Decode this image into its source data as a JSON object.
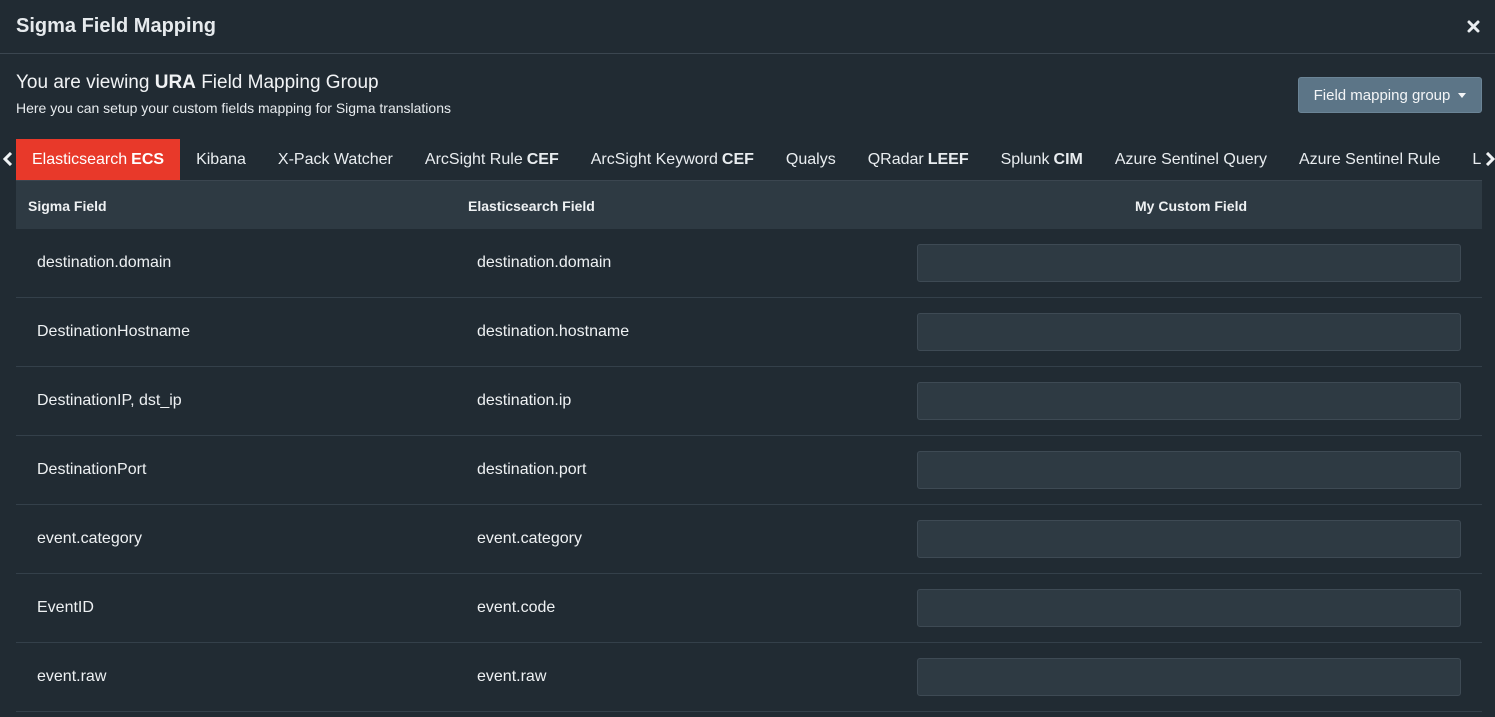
{
  "modal": {
    "title": "Sigma Field Mapping",
    "close_icon": "close-icon"
  },
  "intro": {
    "prefix": "You are viewing",
    "group_name": "URA",
    "suffix": "Field Mapping Group",
    "subtitle": "Here you can setup your custom fields mapping for Sigma translations"
  },
  "group_button": {
    "label": "Field mapping group",
    "icon": "caret-down-icon"
  },
  "tabs": [
    {
      "label": "Elasticsearch",
      "bold": "ECS",
      "active": true
    },
    {
      "label": "Kibana",
      "bold": ""
    },
    {
      "label": "X-Pack Watcher",
      "bold": ""
    },
    {
      "label": "ArcSight Rule",
      "bold": "CEF"
    },
    {
      "label": "ArcSight Keyword",
      "bold": "CEF"
    },
    {
      "label": "Qualys",
      "bold": ""
    },
    {
      "label": "QRadar",
      "bold": "LEEF"
    },
    {
      "label": "Splunk",
      "bold": "CIM"
    },
    {
      "label": "Azure Sentinel Query",
      "bold": ""
    },
    {
      "label": "Azure Sentinel Rule",
      "bold": ""
    },
    {
      "label": "Logpoint",
      "bold": ""
    }
  ],
  "table": {
    "headers": {
      "sigma": "Sigma Field",
      "target": "Elasticsearch Field",
      "custom": "My Custom Field"
    },
    "rows": [
      {
        "sigma": "destination.domain",
        "target": "destination.domain",
        "custom": ""
      },
      {
        "sigma": "DestinationHostname",
        "target": "destination.hostname",
        "custom": ""
      },
      {
        "sigma": "DestinationIP, dst_ip",
        "target": "destination.ip",
        "custom": ""
      },
      {
        "sigma": "DestinationPort",
        "target": "destination.port",
        "custom": ""
      },
      {
        "sigma": "event.category",
        "target": "event.category",
        "custom": ""
      },
      {
        "sigma": "EventID",
        "target": "event.code",
        "custom": ""
      },
      {
        "sigma": "event.raw",
        "target": "event.raw",
        "custom": ""
      }
    ]
  },
  "colors": {
    "background": "#212b33",
    "active_tab": "#e8392a",
    "button": "#5c7587",
    "table_header": "#2e3a43"
  }
}
